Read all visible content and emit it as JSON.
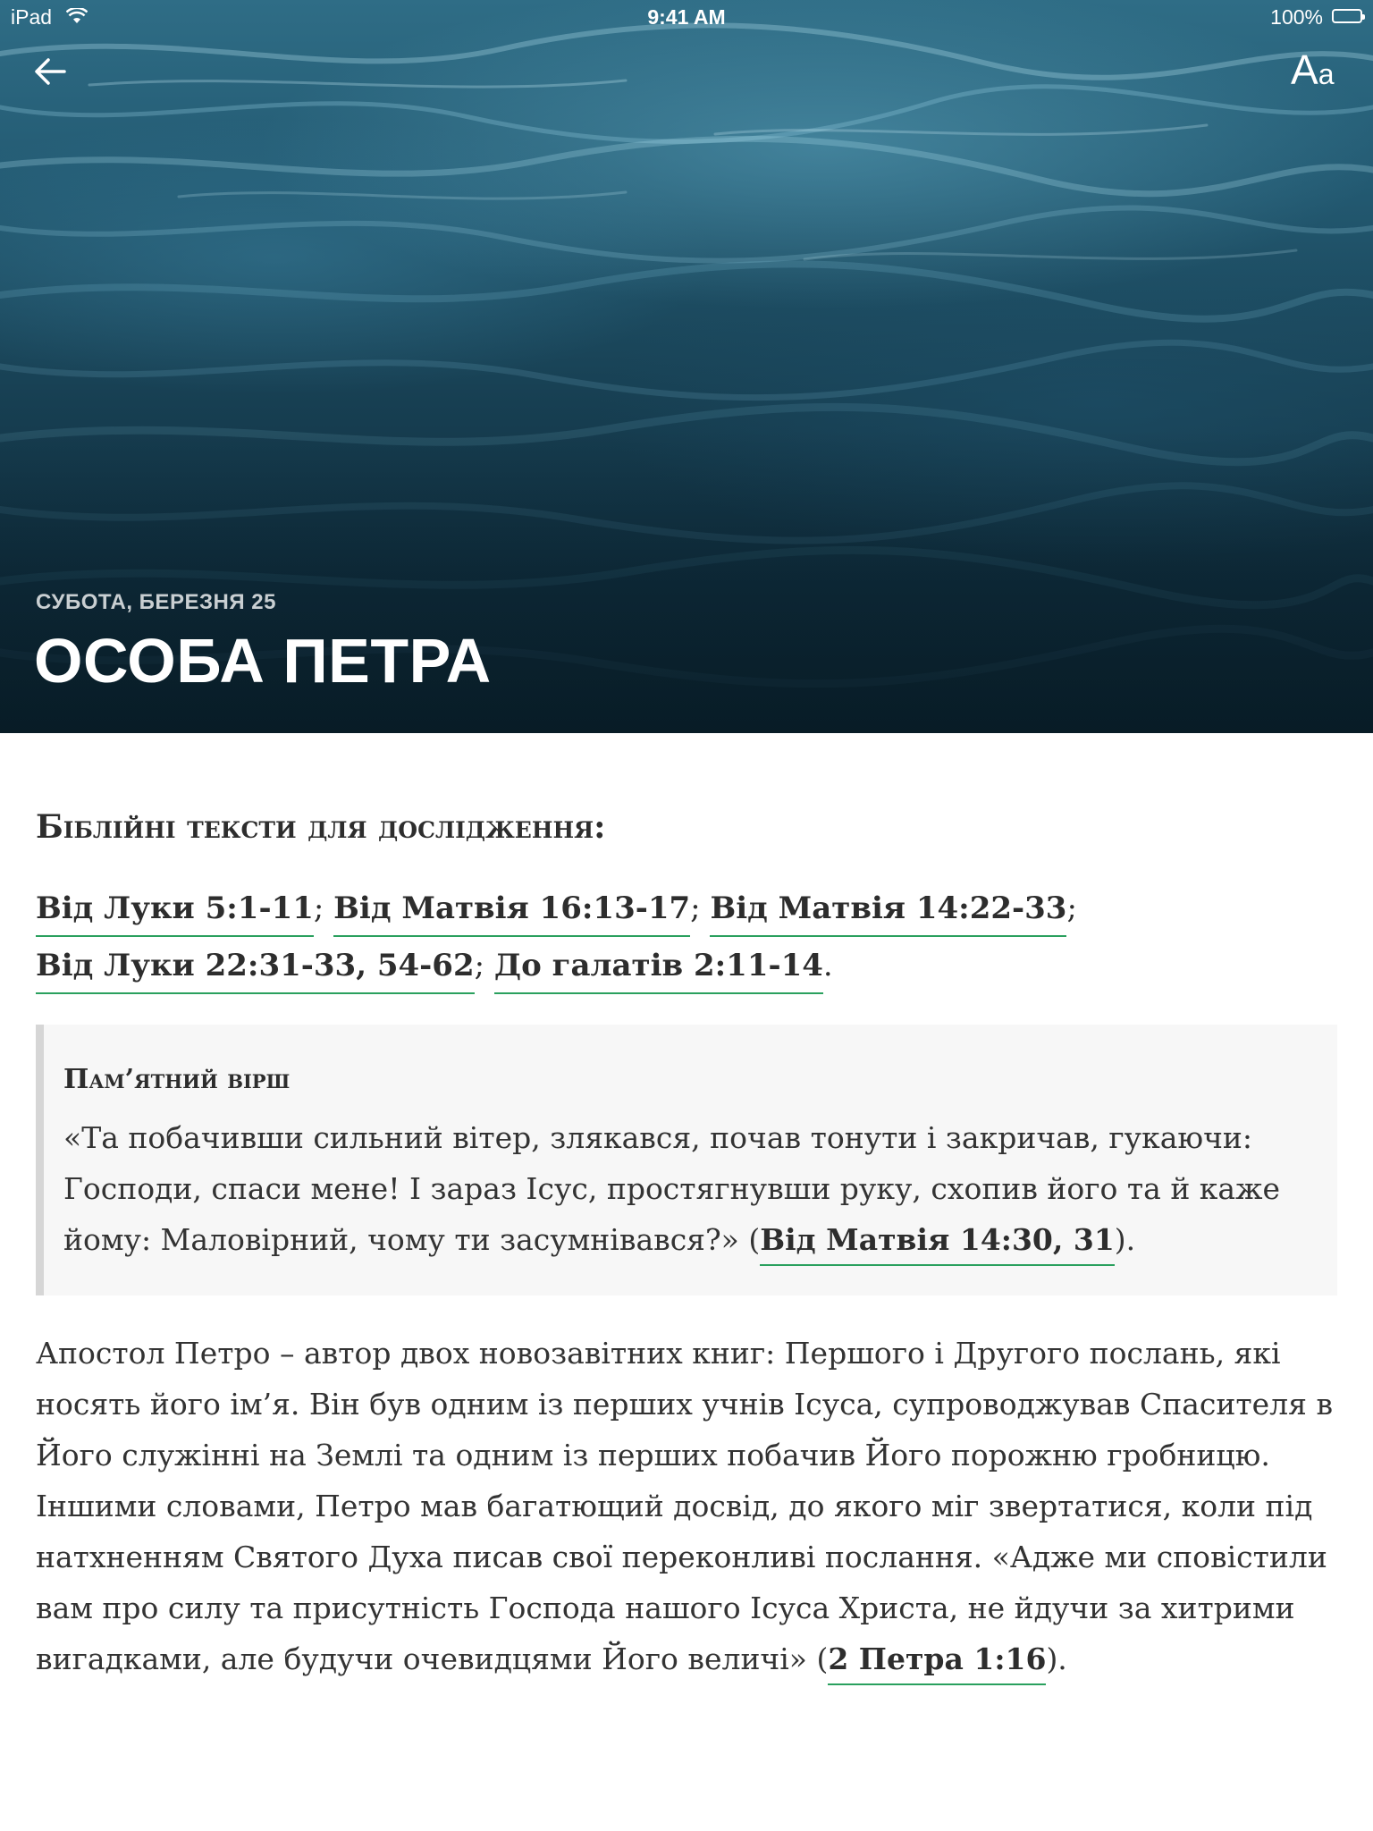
{
  "status_bar": {
    "device": "iPad",
    "time": "9:41 AM",
    "battery": "100%",
    "wifi_icon": "wifi-icon",
    "battery_icon": "battery-icon"
  },
  "toolbar": {
    "back_icon": "arrow-left-icon",
    "font_settings_big": "A",
    "font_settings_small": "a"
  },
  "hero": {
    "date": "СУБОТА, БЕРЕЗНЯ 25",
    "title": "ОСОБА ПЕТРА"
  },
  "study": {
    "heading": "Біблійні тексти для дослідження:",
    "refs": [
      "Від Луки 5:1-11",
      "Від Матвія 16:13-17",
      "Від Матвія 14:22-33",
      "Від Луки 22:31-33, 54-62",
      "До галатів 2:11-14"
    ],
    "separator": ";",
    "end": "."
  },
  "memory_verse": {
    "heading": "Пам’ятний вірш",
    "text": "«Та побачивши сильний вітер, злякався, почав тонути і закричав, гукаючи: Господи, спаси мене! І зараз Ісус, простягнувши руку, схопив його та й каже йому: Маловірний, чому ти засумнівався?» (",
    "ref": "Від Матвія 14:30, 31",
    "end": ")."
  },
  "paragraph": {
    "text": "Апостол Петро – автор двох новозавітних книг: Першого і Другого послань, які носять його ім’я. Він був одним із перших учнів Ісуса, супроводжував Спасителя в Його служінні на Землі та одним із перших побачив Його порожню гробницю. Іншими словами, Петро мав багатющий досвід, до якого міг звертатися, коли під натхненням Святого Духа писав свої переконливі послання. «Адже ми сповістили вам про силу та присутність Господа нашого Ісуса Христа, не йдучи за хитрими вигадками, але будучи очевидцями Його величі» (",
    "ref": "2 Петра 1:16",
    "end": ")."
  },
  "colors": {
    "accent_underline": "#2aa05e",
    "memory_bg": "#f7f7f7",
    "memory_border": "#d6d6d6"
  }
}
